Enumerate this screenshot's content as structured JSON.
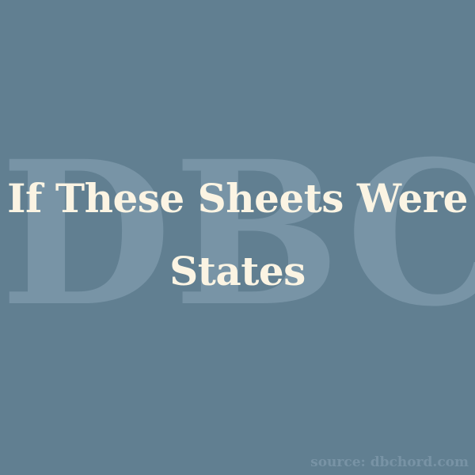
{
  "watermark": {
    "text": "DBC"
  },
  "title": {
    "line1": "If These Sheets Were",
    "line2": "States"
  },
  "source": {
    "text": "source: dbchord.com"
  },
  "colors": {
    "background": "#617f91",
    "watermark": "#7894a6",
    "title": "#fbf4e3",
    "source": "#7893a5"
  }
}
